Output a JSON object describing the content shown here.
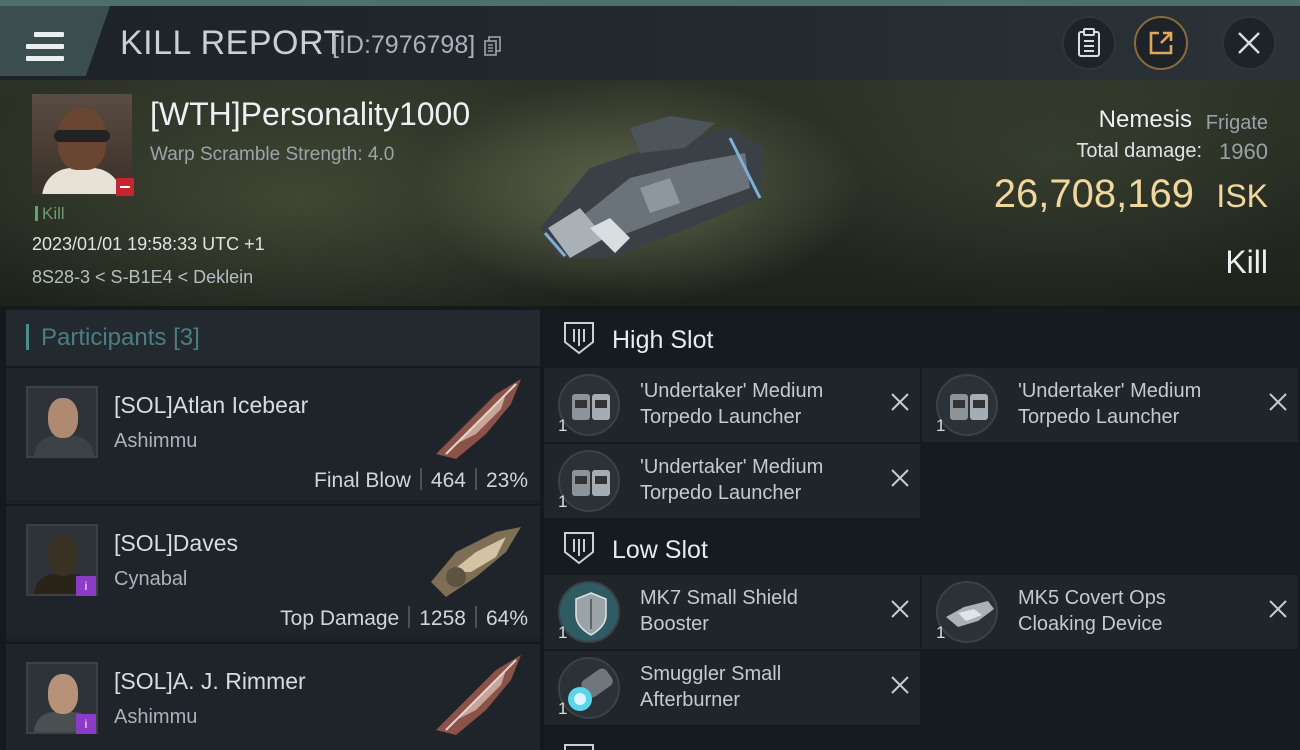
{
  "header": {
    "title": "KILL REPORT",
    "report_id": "[ID:7976798]",
    "icons": [
      "menu-icon",
      "copy-icon",
      "clipboard-icon",
      "share-icon",
      "close-icon"
    ]
  },
  "victim": {
    "name": "[WTH]Personality1000",
    "attribute": "Warp Scramble Strength: 4.0",
    "tag": "Kill",
    "time": "2023/01/01 19:58:33 UTC +1",
    "location": "8S28-3 < S-B1E4 < Deklein",
    "ship_name": "Nemesis",
    "ship_class": "Frigate",
    "total_damage_label": "Total damage:",
    "total_damage": "1960",
    "isk_value": "26,708,169",
    "isk_unit": "ISK",
    "result": "Kill"
  },
  "participants": {
    "title": "Participants",
    "count": "[3]",
    "rows": [
      {
        "name": "[SOL]Atlan Icebear",
        "ship": "Ashimmu",
        "role": "Final Blow",
        "damage": "464",
        "percent": "23%"
      },
      {
        "name": "[SOL]Daves",
        "ship": "Cynabal",
        "role": "Top Damage",
        "damage": "1258",
        "percent": "64%"
      },
      {
        "name": "[SOL]A. J. Rimmer",
        "ship": "Ashimmu",
        "role": "",
        "damage": "",
        "percent": ""
      }
    ]
  },
  "slots": {
    "high": {
      "title": "High Slot",
      "modules": [
        {
          "qty": "1",
          "name": "'Undertaker' Medium Torpedo Launcher"
        },
        {
          "qty": "1",
          "name": "'Undertaker' Medium Torpedo Launcher"
        },
        {
          "qty": "1",
          "name": "'Undertaker' Medium Torpedo Launcher"
        }
      ]
    },
    "low": {
      "title": "Low Slot",
      "modules": [
        {
          "qty": "1",
          "name": "MK7 Small Shield Booster"
        },
        {
          "qty": "1",
          "name": "MK5 Covert Ops Cloaking Device"
        },
        {
          "qty": "1",
          "name": "Smuggler Small Afterburner"
        }
      ]
    }
  },
  "colors": {
    "isk": "#f0d79c",
    "kill_tag": "#5fa86a",
    "participants_accent": "#4e8c8f",
    "badge_red": "#c3262c",
    "badge_purple": "#8a3cc7"
  }
}
